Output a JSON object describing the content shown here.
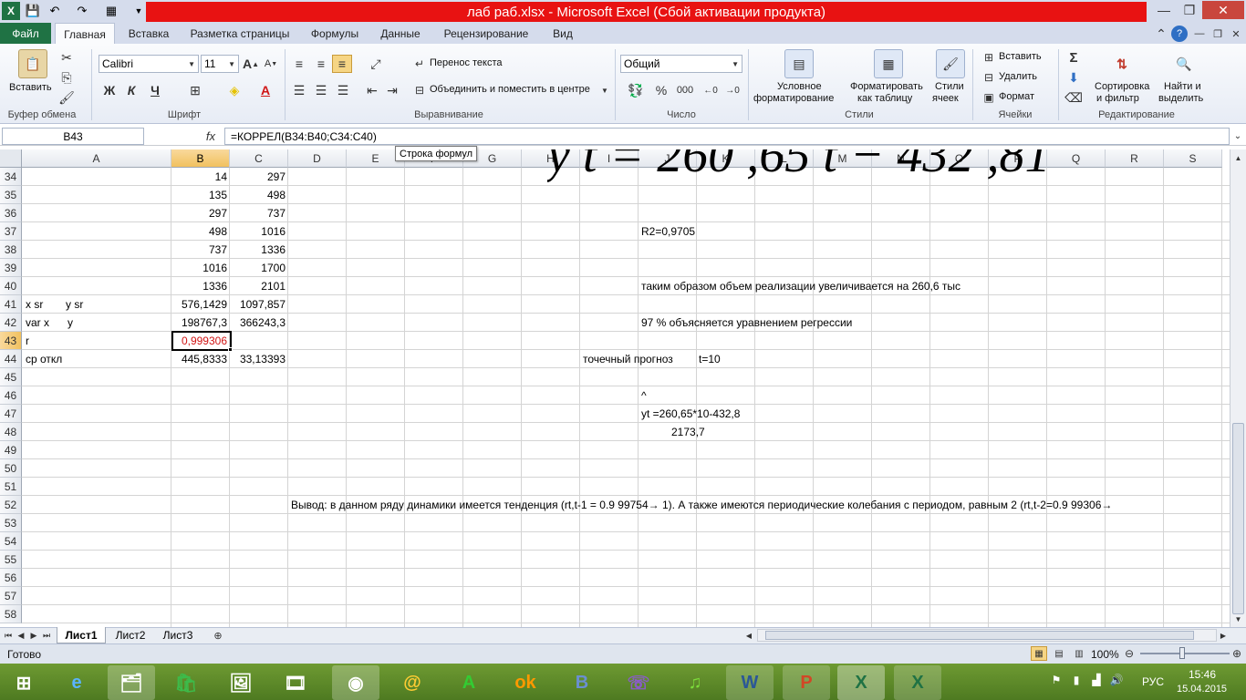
{
  "window": {
    "title": "лаб  раб.xlsx  -  Microsoft Excel (Сбой активации продукта)"
  },
  "tabs": [
    "Файл",
    "Главная",
    "Вставка",
    "Разметка страницы",
    "Формулы",
    "Данные",
    "Рецензирование",
    "Вид"
  ],
  "ribbon": {
    "clipboard": {
      "paste": "Вставить",
      "group": "Буфер обмена"
    },
    "font": {
      "name": "Calibri",
      "size": "11",
      "bold": "Ж",
      "italic": "К",
      "underline": "Ч",
      "group": "Шрифт"
    },
    "alignment": {
      "wrap": "Перенос текста",
      "merge": "Объединить и поместить в центре",
      "group": "Выравнивание"
    },
    "number": {
      "format": "Общий",
      "percent": "%",
      "thousands": "000",
      "group": "Число"
    },
    "styles": {
      "conditional_1": "Условное",
      "conditional_2": "форматирование",
      "table_1": "Форматировать",
      "table_2": "как таблицу",
      "cell_1": "Стили",
      "cell_2": "ячеек",
      "group": "Стили"
    },
    "cells": {
      "insert": "Вставить",
      "delete": "Удалить",
      "format": "Формат",
      "group": "Ячейки"
    },
    "editing": {
      "sigma": "Σ",
      "sort_1": "Сортировка",
      "sort_2": "и фильтр",
      "find_1": "Найти и",
      "find_2": "выделить",
      "group": "Редактирование"
    }
  },
  "formula_bar": {
    "name_box": "B43",
    "fx": "fx",
    "formula": "=КОРРЕЛ(B34:B40;C34:C40)",
    "tooltip": "Строка формул"
  },
  "columns": [
    "A",
    "B",
    "C",
    "D",
    "E",
    "F",
    "G",
    "H",
    "I",
    "J",
    "K",
    "L",
    "M",
    "N",
    "O",
    "P",
    "Q",
    "R",
    "S"
  ],
  "selected_column": "B",
  "selected_row": "43",
  "rows": [
    "34",
    "35",
    "36",
    "37",
    "38",
    "39",
    "40",
    "41",
    "42",
    "43",
    "44",
    "45",
    "46",
    "47",
    "48",
    "49",
    "50",
    "51",
    "52",
    "53",
    "54",
    "55",
    "56",
    "57",
    "58"
  ],
  "cells": {
    "B34": "14",
    "C34": "297",
    "B35": "135",
    "C35": "498",
    "B36": "297",
    "C36": "737",
    "B37": "498",
    "C37": "1016",
    "B38": "737",
    "C38": "1336",
    "B39": "1016",
    "C39": "1700",
    "B40": "1336",
    "C40": "2101",
    "A41a": "x sr",
    "A41b": "y sr",
    "B41": "576,1429",
    "C41": "1097,857",
    "A42a": "var x",
    "A42b": "y",
    "B42": "198767,3",
    "C42": "366243,3",
    "A43": "r",
    "B43": "0,999306",
    "A44": "ср откл",
    "B44": "445,8333",
    "C44": "33,13393",
    "J37": "R2=0,9705",
    "J40": "таким образом объем реализации  увеличивается на 260,6 тыс",
    "J42": "97 % объясняется уравнением регрессии",
    "I44": "точечный прогноз",
    "J44": "t=10",
    "J46": "^",
    "J47": "yt =260,65*10-432,8",
    "J48": "2173,7",
    "E52": "Вывод: в данном ряду динамики имеется тенденция (rt,t-1 = 0.9 99754→ 1). А также имеются периодические колебания с периодом, равным 2 (rt,t-2=0.9 99306→"
  },
  "equation_image": "y t = 260 ,65 t − 432 ,81",
  "sheets": [
    "Лист1",
    "Лист2",
    "Лист3"
  ],
  "active_sheet": "Лист1",
  "status": {
    "ready": "Готово",
    "zoom": "100%"
  },
  "taskbar": {
    "lang": "РУС",
    "time": "15:46",
    "date": "15.04.2015"
  },
  "colors": {
    "title_bar": "#e81212",
    "file_tab": "#1f7244",
    "selection": "#f1c15f",
    "taskbar": "#5e8a29"
  }
}
